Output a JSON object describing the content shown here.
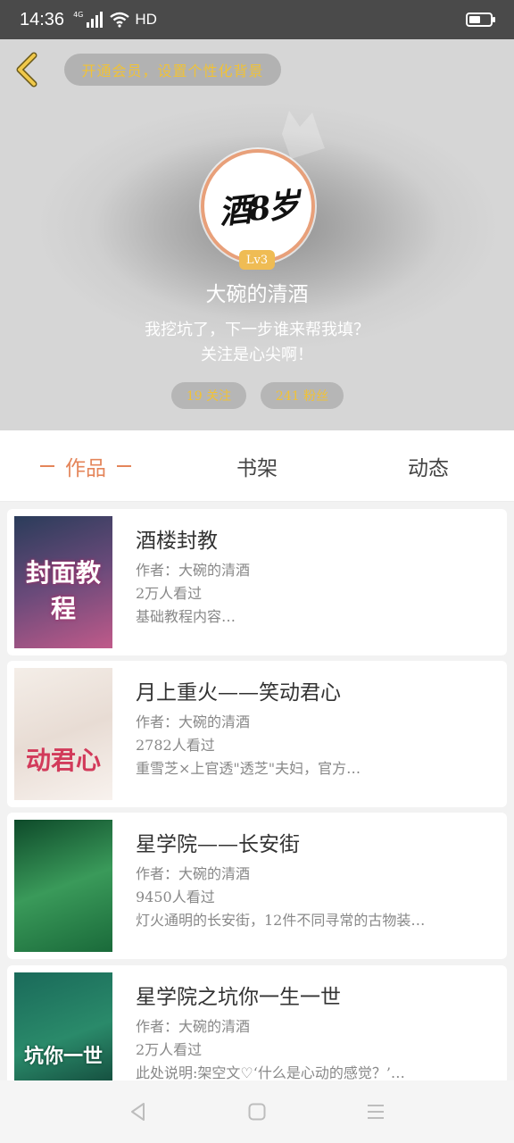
{
  "status_bar": {
    "time": "14:36",
    "network": "4G",
    "hd": "HD"
  },
  "header": {
    "vip_prompt": "开通会员，设置个性化背景",
    "avatar_text": "酒8岁",
    "level": "Lv3",
    "username": "大碗的清酒",
    "bio_line1": "我挖坑了，下一步谁来帮我填？",
    "bio_line2": "关注是心尖啊！",
    "following": "19 关注",
    "followers": "241 粉丝"
  },
  "tabs": [
    {
      "label": "作品"
    },
    {
      "label": "书架"
    },
    {
      "label": "动态"
    }
  ],
  "works": [
    {
      "title": "酒楼封教",
      "author": "作者：大碗的清酒",
      "views": "2万人看过",
      "desc": "基础教程内容…",
      "cover_text": "封面教程",
      "cover_colors": [
        "#2a3c5a",
        "#6a4a7a",
        "#c05a8a"
      ]
    },
    {
      "title": "月上重火——笑动君心",
      "author": "作者：大碗的清酒",
      "views": "2782人看过",
      "desc": "重雪芝×上官透\"透芝\"夫妇，官方…",
      "cover_text": "动君心",
      "cover_colors": [
        "#f4eee8",
        "#e8dcd4",
        "#f8f2ee"
      ]
    },
    {
      "title": "星学院——长安街",
      "author": "作者：大碗的清酒",
      "views": "9450人看过",
      "desc": "灯火通明的长安街，12件不同寻常的古物装…",
      "cover_text": "",
      "cover_colors": [
        "#0e4a2a",
        "#3a9a5a",
        "#1a6a3a"
      ]
    },
    {
      "title": "星学院之坑你一生一世",
      "author": "作者：大碗的清酒",
      "views": "2万人看过",
      "desc": "此处说明:架空文♡‘什么是心动的感觉？’…",
      "cover_text": "坑你一世",
      "cover_colors": [
        "#1a6a5a",
        "#2a8a6a",
        "#0e3a30"
      ]
    }
  ]
}
